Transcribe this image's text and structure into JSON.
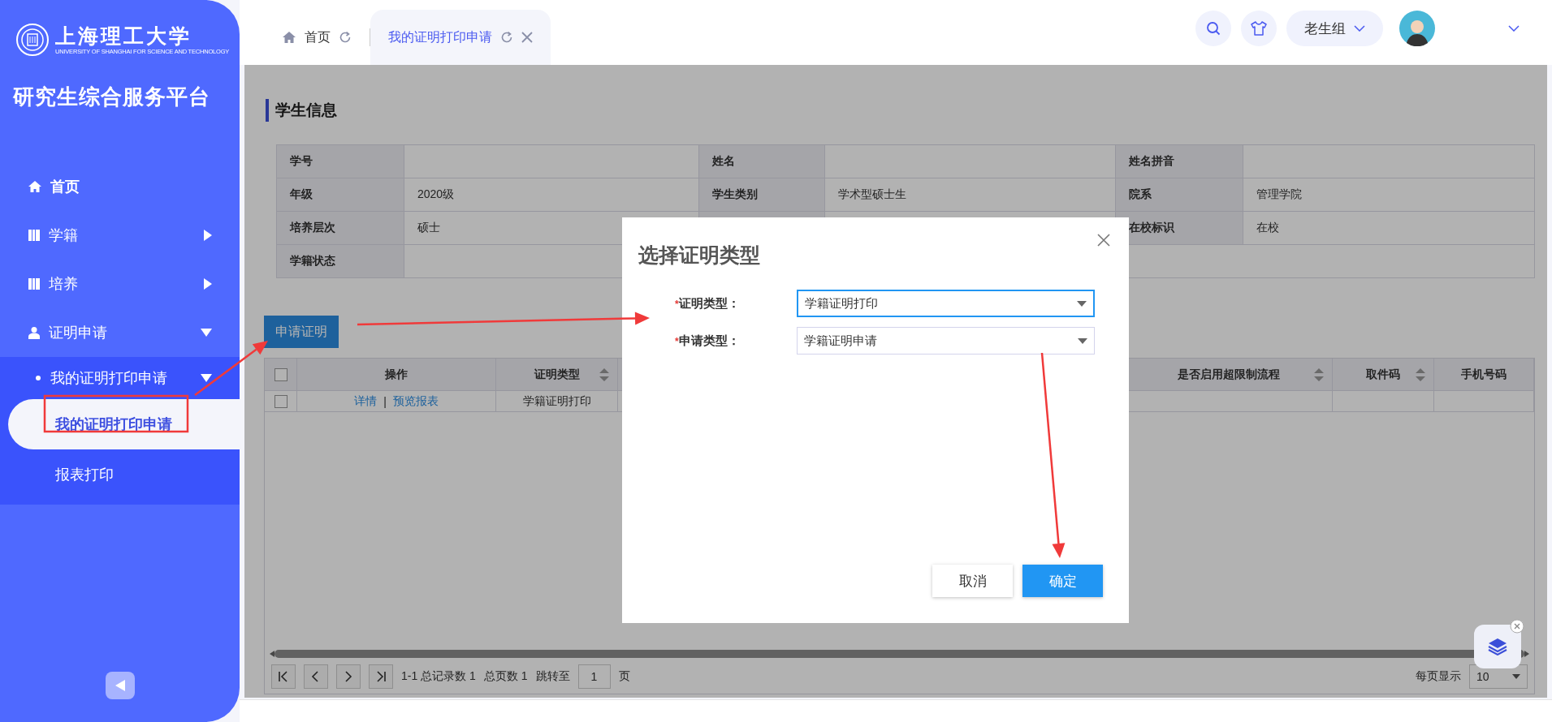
{
  "sidebar": {
    "logo": {
      "name": "上海理工大学",
      "subtitle": "UNIVERSITY OF SHANGHAI FOR SCIENCE AND TECHNOLOGY"
    },
    "title": "研究生综合服务平台",
    "items": [
      {
        "label": "首页",
        "kind": "home"
      },
      {
        "label": "学籍",
        "kind": "book",
        "expanded": false
      },
      {
        "label": "培养",
        "kind": "book",
        "expanded": false
      },
      {
        "label": "证明申请",
        "kind": "person",
        "expanded": true,
        "children": [
          {
            "label": "我的证明打印申请",
            "kind": "dot",
            "expanded": true,
            "children": [
              {
                "label": "我的证明打印申请",
                "selected": true
              },
              {
                "label": "报表打印",
                "selected": false
              }
            ]
          }
        ]
      }
    ]
  },
  "topbar": {
    "tabs": [
      {
        "label": "首页",
        "kind": "home",
        "selected": false,
        "closable": false
      },
      {
        "label": "我的证明打印申请",
        "kind": "page",
        "selected": true,
        "closable": true
      }
    ],
    "group": "老生组"
  },
  "student_info": {
    "title": "学生信息",
    "rows": [
      [
        {
          "label": "学号"
        },
        {
          "label": "姓名"
        },
        {
          "label": "姓名拼音"
        }
      ],
      [
        {
          "label": "年级",
          "value": "2020级"
        },
        {
          "label": "学生类别",
          "value": "学术型硕士生"
        },
        {
          "label": "院系",
          "value": "管理学院"
        }
      ],
      [
        {
          "label": "培养层次",
          "value": "硕士"
        },
        {},
        {
          "label": "在校标识",
          "value": "在校"
        }
      ],
      [
        {
          "label": "学籍状态"
        }
      ]
    ]
  },
  "apply_button": "申请证明",
  "records": {
    "columns": [
      {
        "label": "操作",
        "sortable": false
      },
      {
        "label": "证明类型",
        "sortable": true
      },
      {},
      {
        "label": "是否启用超限制流程",
        "sortable": true
      },
      {
        "label": "取件码",
        "sortable": true
      },
      {
        "label": "手机号码",
        "sortable": false
      }
    ],
    "header_checked": false,
    "rows": [
      {
        "checked": false,
        "actions": [
          "详情",
          "预览报表"
        ],
        "separator": "|",
        "cells": [
          "",
          "学籍证明打印"
        ]
      }
    ],
    "pager": {
      "summary": "1-1 总记录数 1",
      "pages": "总页数 1",
      "jump_label": "跳转至",
      "page": "1",
      "page_unit": "页",
      "per_page_label": "每页显示",
      "per_page": "10"
    }
  },
  "dialog": {
    "title": "选择证明类型",
    "fields": [
      {
        "required_mark": "*",
        "label": "证明类型：",
        "value": "学籍证明打印",
        "focused": true
      },
      {
        "required_mark": "*",
        "label": "申请类型：",
        "value": "学籍证明申请",
        "focused": false
      }
    ],
    "buttons": [
      {
        "label": "取消",
        "kind": "secondary"
      },
      {
        "label": "确定",
        "kind": "primary"
      }
    ]
  }
}
